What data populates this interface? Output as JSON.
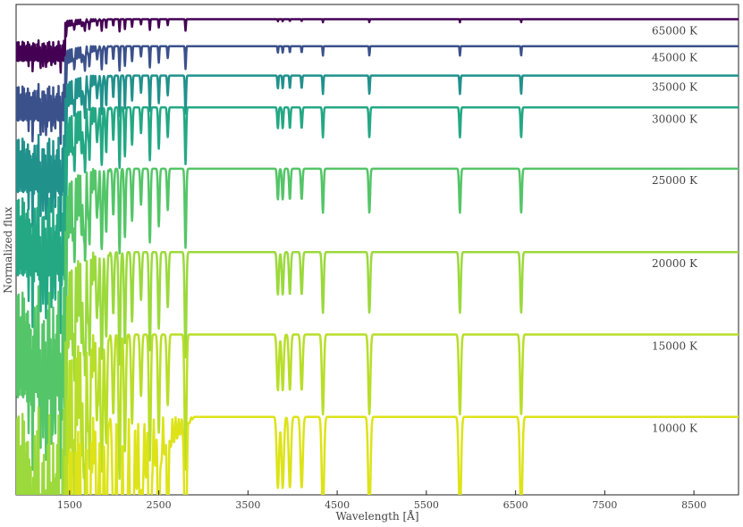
{
  "chart_data": {
    "type": "line",
    "title": "",
    "xlabel": "Wavelength [Å]",
    "ylabel": "Normalized flux",
    "xlim": [
      900,
      9000
    ],
    "ylim": [
      0,
      1
    ],
    "grid": false,
    "y_tick_labels_shown": false,
    "x_ticks": [
      1500,
      2500,
      3500,
      4500,
      5500,
      6500,
      7500,
      8500
    ],
    "x_tick_labels": [
      "1500",
      "2500",
      "3500",
      "4500",
      "5500",
      "6500",
      "7500",
      "8500"
    ],
    "colormap": "viridis",
    "series": [
      {
        "name": "65000 K",
        "label": "65000 K",
        "continuum": 0.97,
        "color": "#440154"
      },
      {
        "name": "45000 K",
        "label": "45000 K",
        "continuum": 0.915,
        "color": "#3b518b"
      },
      {
        "name": "35000 K",
        "label": "35000 K",
        "continuum": 0.855,
        "color": "#21918c"
      },
      {
        "name": "30000 K",
        "label": "30000 K",
        "continuum": 0.79,
        "color": "#24a884"
      },
      {
        "name": "25000 K",
        "label": "25000 K",
        "continuum": 0.665,
        "color": "#54c568"
      },
      {
        "name": "20000 K",
        "label": "20000 K",
        "continuum": 0.495,
        "color": "#9bd93c"
      },
      {
        "name": "15000 K",
        "label": "15000 K",
        "continuum": 0.327,
        "color": "#b8de29"
      },
      {
        "name": "10000 K",
        "label": "10000 K",
        "continuum": 0.159,
        "color": "#dde318"
      }
    ],
    "absorption_lines_angstrom": [
      3835,
      3889,
      3970,
      4102,
      4340,
      4861,
      5876,
      6563
    ]
  }
}
